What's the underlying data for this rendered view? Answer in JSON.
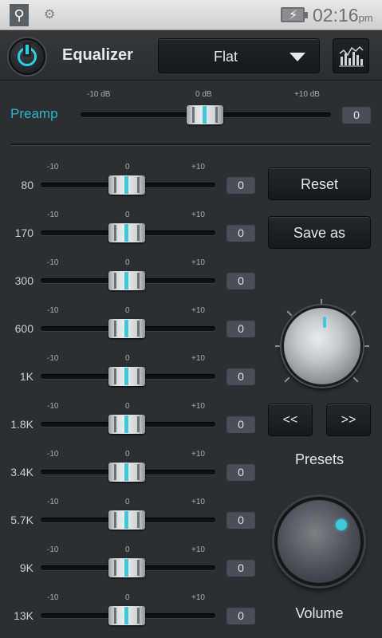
{
  "status_bar": {
    "time": "02:16",
    "ampm": "pm",
    "icons": [
      "usb-icon",
      "android-debug-icon",
      "battery-charging-icon"
    ]
  },
  "header": {
    "title": "Equalizer",
    "preset": "Flat",
    "icons": [
      "power-icon",
      "visualizer-icon"
    ]
  },
  "preamp": {
    "label": "Preamp",
    "scale": [
      "-10 dB",
      "0 dB",
      "+10 dB"
    ],
    "value": "0"
  },
  "band_scale": [
    "-10",
    "0",
    "+10"
  ],
  "bands": [
    {
      "freq": "80",
      "value": "0"
    },
    {
      "freq": "170",
      "value": "0"
    },
    {
      "freq": "300",
      "value": "0"
    },
    {
      "freq": "600",
      "value": "0"
    },
    {
      "freq": "1K",
      "value": "0"
    },
    {
      "freq": "1.8K",
      "value": "0"
    },
    {
      "freq": "3.4K",
      "value": "0"
    },
    {
      "freq": "5.7K",
      "value": "0"
    },
    {
      "freq": "9K",
      "value": "0"
    },
    {
      "freq": "13K",
      "value": "0"
    }
  ],
  "controls": {
    "reset": "Reset",
    "save_as": "Save as",
    "prev": "<<",
    "next": ">>",
    "presets_label": "Presets",
    "volume_label": "Volume"
  },
  "colors": {
    "accent": "#3ec8d8",
    "background": "#2b2f34"
  }
}
